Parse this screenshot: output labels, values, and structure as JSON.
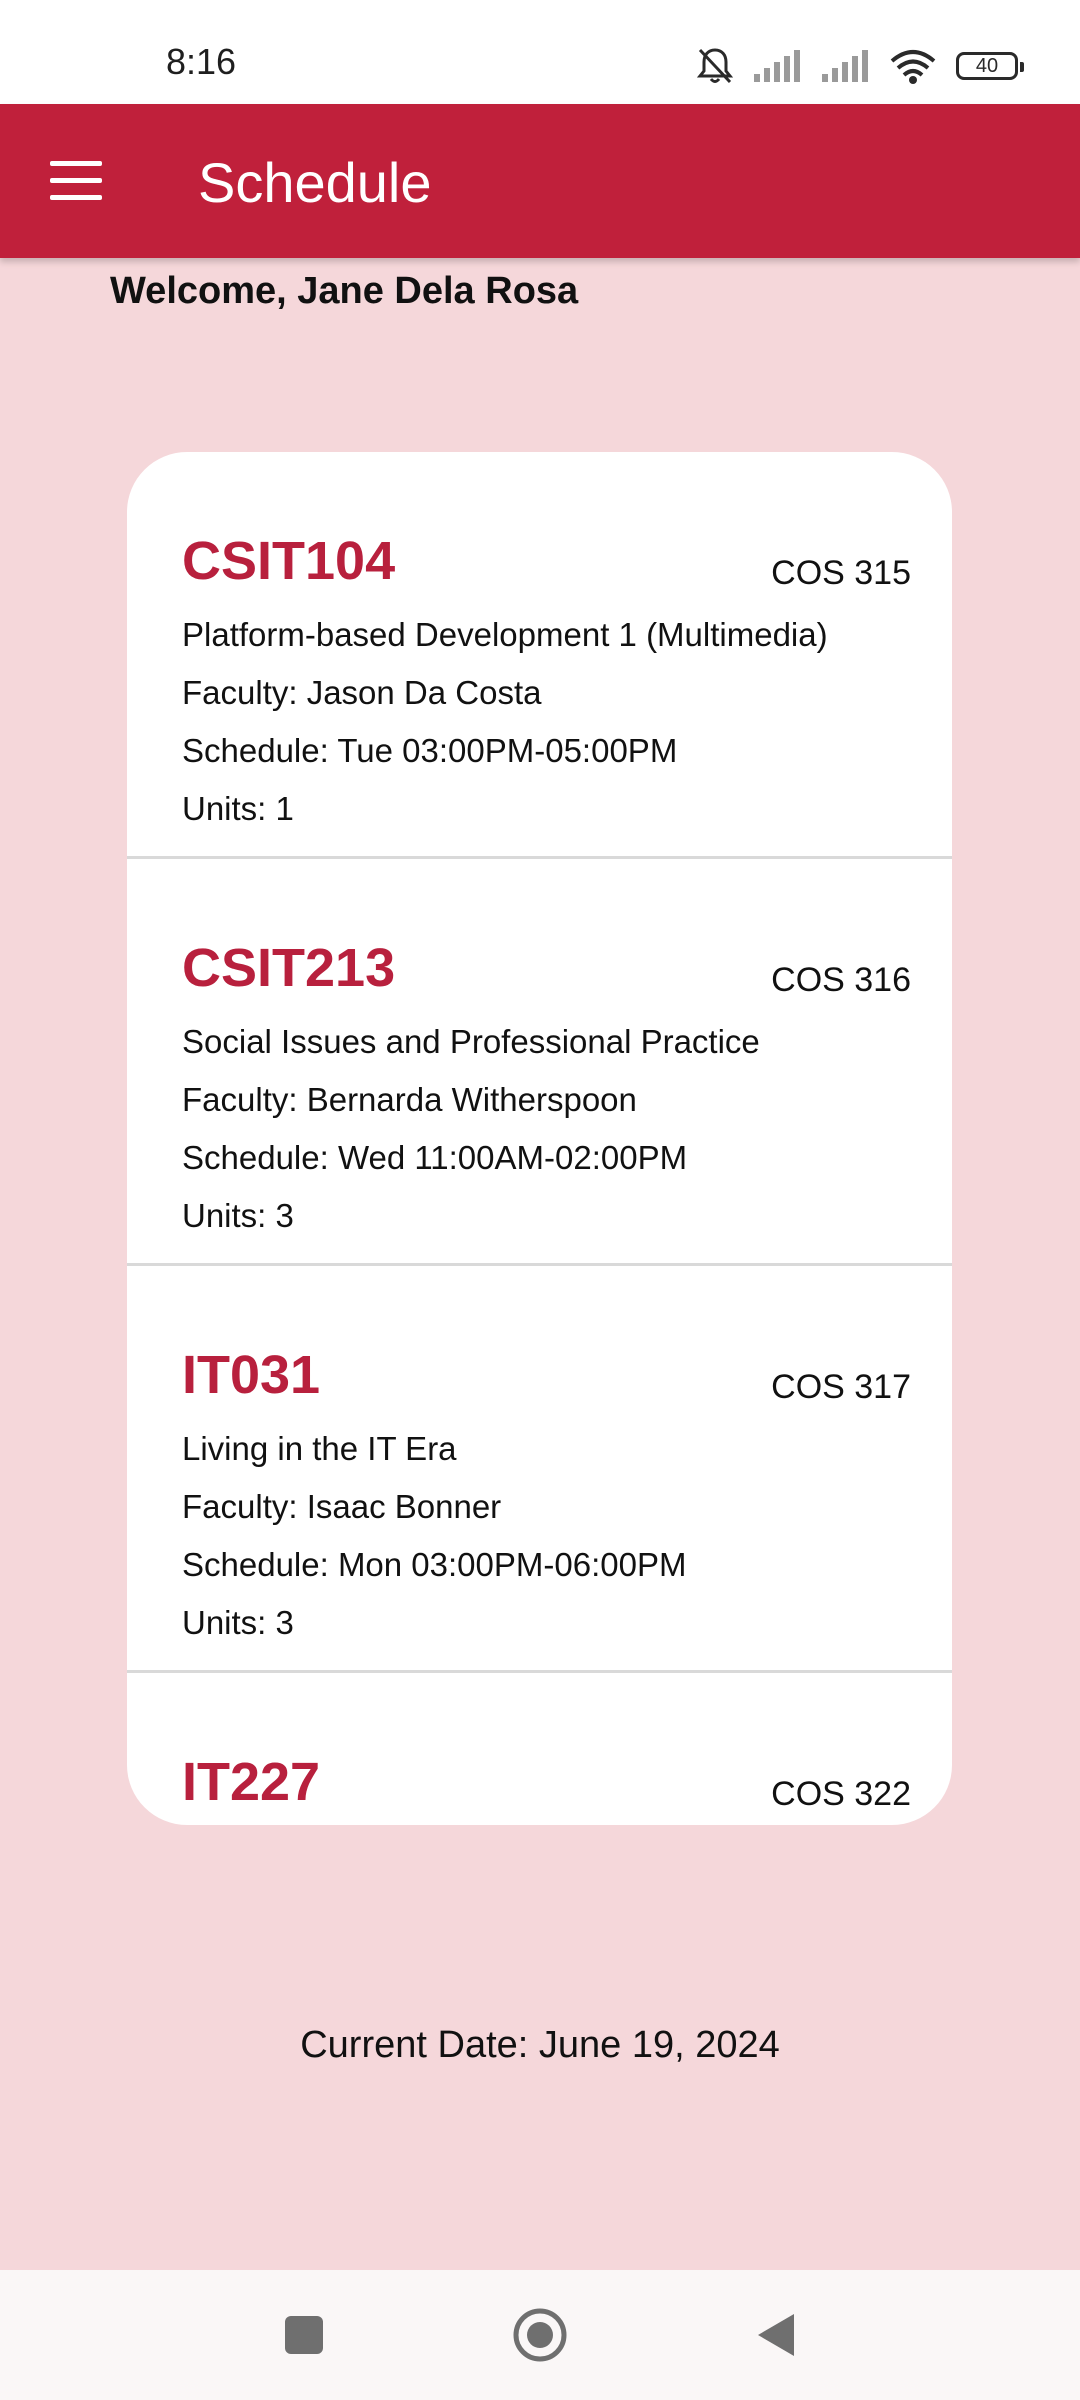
{
  "status_bar": {
    "time": "8:16",
    "battery": "40",
    "icons": [
      "mute-icon",
      "signal-icon",
      "signal-icon",
      "wifi-icon",
      "battery-icon"
    ]
  },
  "app_bar": {
    "title": "Schedule",
    "menu_icon": "hamburger-menu-icon",
    "color": "#c0203b"
  },
  "welcome": "Welcome, Jane Dela Rosa",
  "courses": [
    {
      "code": "CSIT104",
      "room": "COS 315",
      "title": "Platform-based Development 1 (Multimedia)",
      "faculty": "Faculty: Jason Da Costa",
      "schedule": "Schedule: Tue 03:00PM-05:00PM",
      "units": "Units: 1"
    },
    {
      "code": "CSIT213",
      "room": "COS 316",
      "title": "Social Issues and Professional Practice",
      "faculty": "Faculty: Bernarda Witherspoon",
      "schedule": "Schedule: Wed 11:00AM-02:00PM",
      "units": "Units: 3"
    },
    {
      "code": "IT031",
      "room": "COS 317",
      "title": "Living in the IT Era",
      "faculty": "Faculty: Isaac Bonner",
      "schedule": "Schedule: Mon 03:00PM-06:00PM",
      "units": "Units: 3"
    },
    {
      "code": "IT227",
      "room": "COS 322"
    }
  ],
  "current_date": "Current Date: June 19, 2024",
  "nav_bar": {
    "buttons": [
      "recent-apps-icon",
      "home-icon",
      "back-icon"
    ]
  },
  "colors": {
    "accent": "#c0203b",
    "course_code": "#b8203d",
    "background": "#f5d7da",
    "card": "#ffffff"
  }
}
